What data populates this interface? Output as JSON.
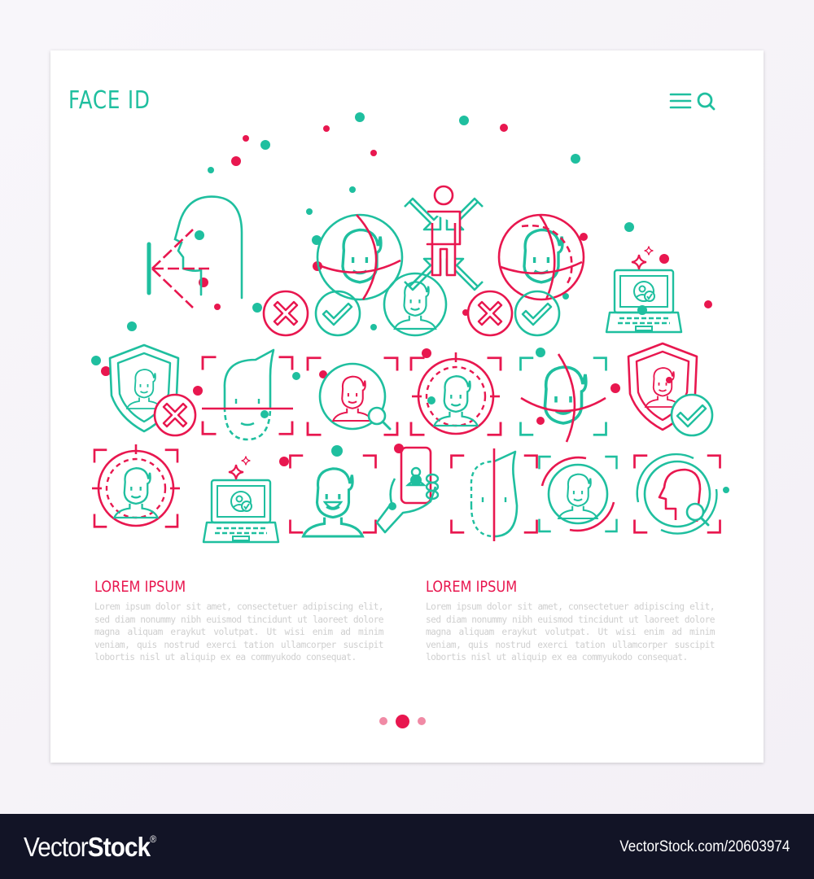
{
  "colors": {
    "teal": "#1fbf9f",
    "pink": "#e8174f",
    "pink_light": "#f08aa5",
    "body_text": "#cfcfcf",
    "footer_bg": "#121426"
  },
  "header": {
    "title": "FACE ID",
    "icons": [
      "menu-icon",
      "search-icon"
    ]
  },
  "illustration": {
    "shape": "half-circle",
    "icons": [
      "face-scan-profile-icon",
      "face-3d-globe-icon",
      "full-body-scan-icon",
      "face-rotation-globe-icon",
      "laptop-face-verified-icon",
      "reject-x-icon",
      "approve-check-icon",
      "face-avatar-circle-icon",
      "reject-x-icon-2",
      "approve-check-icon-2",
      "shield-face-rejected-icon",
      "face-scan-line-icon",
      "face-search-icon",
      "face-target-icon",
      "face-grid-icon",
      "shield-face-approved-icon",
      "face-target-icon-2",
      "laptop-face-verified-icon-2",
      "smiling-face-frame-icon",
      "phone-face-scan-icon",
      "half-face-scan-icon",
      "face-circle-frame-icon",
      "head-profile-search-icon"
    ]
  },
  "sections": [
    {
      "heading": "LOREM IPSUM",
      "body": "Lorem ipsum dolor sit amet, consectetuer adipiscing elit, sed diam nonummy nibh euismod tincidunt ut laoreet dolore magna aliquam eraykut volutpat. Ut wisi enim ad minim veniam, quis nostrud exerci tation ullamcorper suscipit lobortis nisl ut aliquip ex ea commyukodo consequat."
    },
    {
      "heading": "LOREM IPSUM",
      "body": "Lorem ipsum dolor sit amet, consectetuer adipiscing elit, sed diam nonummy nibh euismod tincidunt ut laoreet dolore magna aliquam eraykut volutpat. Ut wisi enim ad minim veniam, quis nostrud exerci tation ullamcorper suscipit lobortis nisl ut aliquip ex ea commyukodo consequat."
    }
  ],
  "pagination": {
    "count": 3,
    "active": 2
  },
  "footer": {
    "brand_light": "Vector",
    "brand_bold": "Stock",
    "brand_mark": "®",
    "url": "VectorStock.com/20603974"
  }
}
